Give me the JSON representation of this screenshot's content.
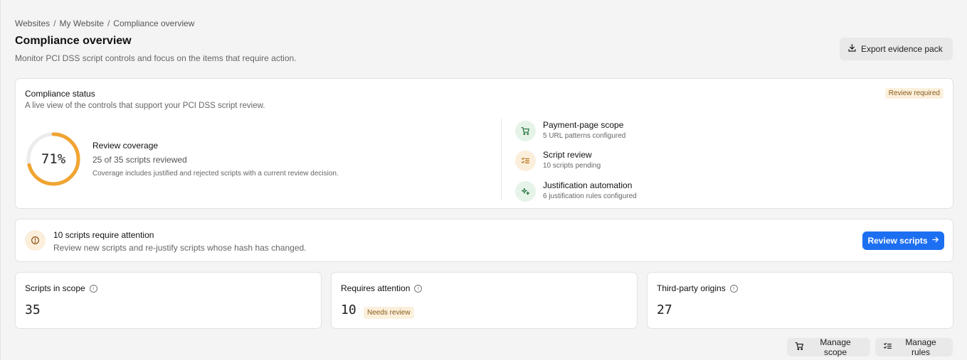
{
  "breadcrumb": [
    "Websites",
    "My Website",
    "Compliance overview"
  ],
  "header": {
    "title": "Compliance overview",
    "subtitle": "Monitor PCI DSS script controls and focus on the items that require action.",
    "export_label": "Export evidence pack"
  },
  "status": {
    "title": "Compliance status",
    "subtitle": "A live view of the controls that support your PCI DSS script review.",
    "badge": "Review required",
    "coverage_percent": 71,
    "coverage_label": "71%",
    "coverage_title": "Review coverage",
    "coverage_count": "25 of 35 scripts reviewed",
    "coverage_note": "Coverage includes justified and rejected scripts with a current review decision.",
    "controls": [
      {
        "title": "Payment-page scope",
        "subtitle": "5 URL patterns configured",
        "icon": "cart-icon"
      },
      {
        "title": "Script review",
        "subtitle": "10 scripts pending",
        "icon": "checklist-icon"
      },
      {
        "title": "Justification automation",
        "subtitle": "6 justification rules configured",
        "icon": "sparkle-icon"
      }
    ],
    "colors": {
      "ring": "#f0a431",
      "ring_track": "#ececec"
    }
  },
  "attention": {
    "title": "10 scripts require attention",
    "subtitle": "Review new scripts and re-justify scripts whose hash has changed.",
    "button": "Review scripts",
    "button_color": "#1d6ff2"
  },
  "metrics": [
    {
      "label": "Scripts in scope",
      "value": "35"
    },
    {
      "label": "Requires attention",
      "value": "10",
      "badge": "Needs review"
    },
    {
      "label": "Third-party origins",
      "value": "27"
    }
  ],
  "footer": {
    "manage_scope": "Manage scope",
    "manage_rules": "Manage rules"
  }
}
